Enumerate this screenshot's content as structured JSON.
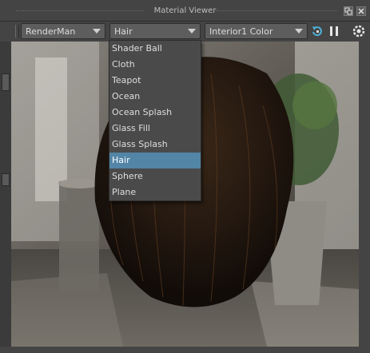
{
  "window": {
    "title": "Material Viewer"
  },
  "toolbar": {
    "renderer": {
      "value": "RenderMan"
    },
    "shape": {
      "value": "Hair"
    },
    "environment": {
      "value": "Interior1 Color"
    }
  },
  "shape_menu": {
    "items": [
      {
        "label": "Shader Ball"
      },
      {
        "label": "Cloth"
      },
      {
        "label": "Teapot"
      },
      {
        "label": "Ocean"
      },
      {
        "label": "Ocean Splash"
      },
      {
        "label": "Glass Fill"
      },
      {
        "label": "Glass Splash"
      },
      {
        "label": "Hair",
        "selected": true
      },
      {
        "label": "Sphere"
      },
      {
        "label": "Plane"
      }
    ]
  },
  "icons": {
    "dock": "dock-icon",
    "close": "close-icon",
    "refresh": "refresh-render-icon",
    "pause": "pause-icon",
    "settings": "settings-icon"
  },
  "colors": {
    "panel": "#444444",
    "combo": "#5d5d5d",
    "selection": "#5285a6"
  }
}
